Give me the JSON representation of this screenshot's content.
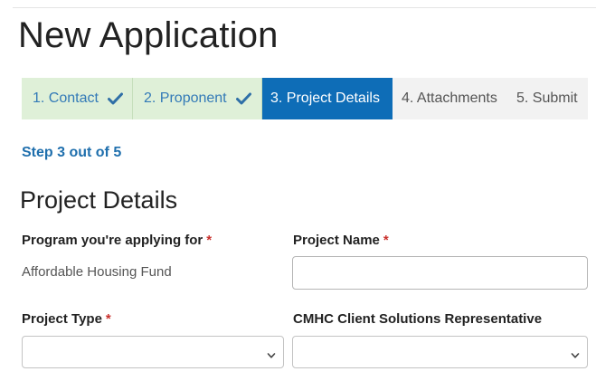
{
  "page": {
    "title": "New Application"
  },
  "stepper": {
    "steps": [
      {
        "label": "1. Contact",
        "status": "done"
      },
      {
        "label": "2. Proponent",
        "status": "done"
      },
      {
        "label": "3. Project Details",
        "status": "active"
      },
      {
        "label": "4. Attachments",
        "status": "todo"
      },
      {
        "label": "5. Submit",
        "status": "todo"
      }
    ],
    "colors": {
      "done_bg": "#dff0d8",
      "done_text": "#337ab7",
      "active_bg": "#0e6db7",
      "active_text": "#ffffff",
      "todo_bg": "#f2f2f2"
    }
  },
  "progress": {
    "text": "Step 3 out of 5",
    "current": 3,
    "total": 5
  },
  "section": {
    "title": "Project Details"
  },
  "fields": {
    "program": {
      "label": "Program you're applying for",
      "required_mark": "*",
      "value": "Affordable Housing Fund"
    },
    "project_name": {
      "label": "Project Name",
      "required_mark": "*",
      "value": ""
    },
    "project_type": {
      "label": "Project Type",
      "required_mark": "*",
      "selected": ""
    },
    "cmhc_rep": {
      "label": "CMHC Client Solutions Representative",
      "selected": ""
    }
  },
  "icons": {
    "check": "check-icon",
    "chevron": "chevron-down-icon"
  }
}
